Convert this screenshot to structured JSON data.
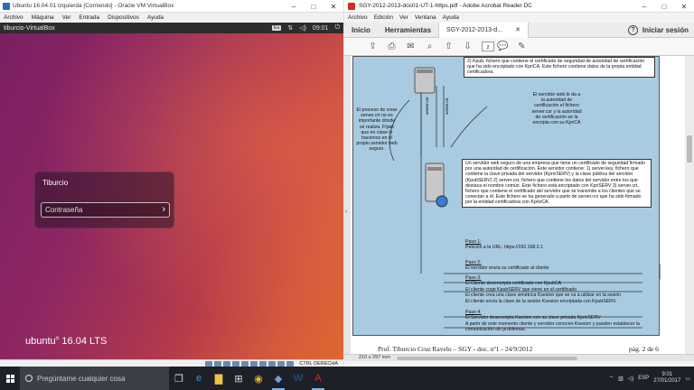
{
  "vbox": {
    "title": "Ubuntu 16.04.01 Izquierda [Corriendo] - Oracle VM VirtualBox",
    "menu": [
      "Archivo",
      "Máquina",
      "Ver",
      "Entrada",
      "Dispositivos",
      "Ayuda"
    ],
    "status_key": "CTRL DERECHA"
  },
  "ubuntu": {
    "hostname": "tiburcio-VirtualBox",
    "keyboard": "Es",
    "time": "09:01",
    "user": "Tiburcio",
    "password_placeholder": "Contraseña",
    "logo": "ubuntu",
    "version": "16.04 LTS"
  },
  "adobe": {
    "title": "SGY-2012-2013-doc01-UT-1-https.pdf - Adobe Acrobat Reader DC",
    "menu": [
      "Archivo",
      "Edición",
      "Ver",
      "Ventana",
      "Ayuda"
    ],
    "tabs": [
      "Inicio",
      "Herramientas"
    ],
    "doc_tab": "SGY-2012-2013-d...",
    "login": "Iniciar sesión",
    "page_current": "2",
    "page_total": "/ 6",
    "page_size": "210 x 297 mm"
  },
  "pdf": {
    "top_note": "2) Kpub, fichero que contiene el certificado de seguridad de autoridad de certificación que ha sido encriptado con KpriCA. Este fichero contiene datos de la propia entidad certificadora.",
    "left_note": "El proceso de crear server.crt no es importante dónde se realiza. Fíjate que en clase lo hacemos en el propio servidor web seguro.",
    "right_note": "El servidor web le da a la autoridad de certificación el fichero server.csr y la autoridad de certificación se la encripta con su KpriCA",
    "arrow_label_1": "server.csr",
    "arrow_label_2": "server.crt",
    "server_box": "Un servidor web seguro de una empresa que tiene un certificado de seguridad firmado por una autoridad de certificación. Este servidor contiene: 1) server.key, fichero que contiene la clave privada del servidor (KprivSERV) y la clave pública del servidor (KpubSERV) 2) server.csr, fichero que contiene los datos del servidor entre los que destaca el nombre común. Este fichero está encriptado con KpriSERV 3) server.crt, fichero que contiene el certificado del servidor que se transmite a los clientes que se conectan a él. Este fichero se ha generado a partir de server.crs que ha sido firmado por la entidad certificadora con KprivCA.",
    "steps": [
      {
        "title": "Paso 1:",
        "text": [
          "Petición a la URL: https://192.168.2.1"
        ]
      },
      {
        "title": "Paso 2:",
        "text": [
          "El servidor envía su certificado al cliente"
        ]
      },
      {
        "title": "Paso 3:",
        "text": [
          "El Cliente desencripta certificado con KpubCA",
          "El cliente coge KpubSERV que viene en el certificado",
          "El cliente crea una clave simétrica Ksesion que se va a utilizar en la sesión",
          "El cliente envía la clave de la sesión Ksesion encriptada con KpubSERV."
        ]
      },
      {
        "title": "Paso 4:",
        "text": [
          "El Servidor desencripta Ksesion con su clave privada KprivSERV",
          "A partir de este momento cliente y servidor conocen Ksesion y pueden establecer la comunicación sin problemas."
        ]
      }
    ],
    "footer_left": "Prof. Tiburcio Cruz Ravelo – SGY - doc. nº1 - 24/9/2012",
    "footer_right": "pág. 2 de 6"
  },
  "taskbar": {
    "search_placeholder": "Pregúntame cualquier cosa",
    "lang": "ESP",
    "time": "9:01",
    "date": "27/01/2017"
  }
}
